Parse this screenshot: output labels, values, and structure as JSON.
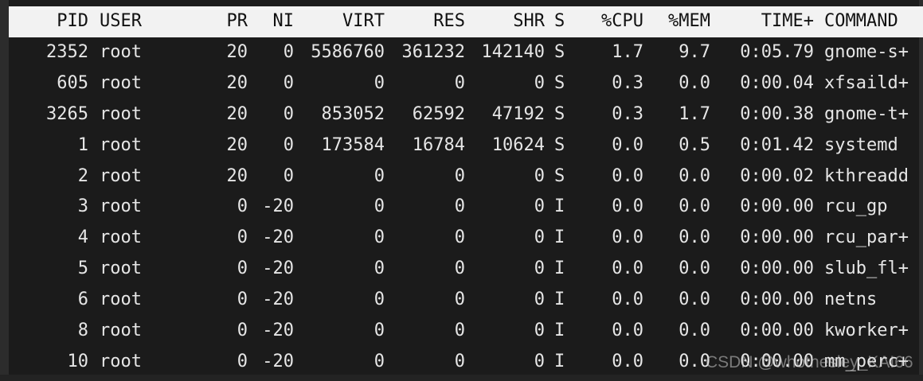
{
  "top": {
    "headers": {
      "pid": "PID",
      "user": "USER",
      "pr": "PR",
      "ni": "NI",
      "virt": "VIRT",
      "res": "RES",
      "shr": "SHR",
      "s": "S",
      "cpu": "%CPU",
      "mem": "%MEM",
      "time": "TIME+",
      "command": "COMMAND"
    },
    "rows": [
      {
        "pid": "2352",
        "user": "root",
        "pr": "20",
        "ni": "0",
        "virt": "5586760",
        "res": "361232",
        "shr": "142140",
        "s": "S",
        "cpu": "1.7",
        "mem": "9.7",
        "time": "0:05.79",
        "command": "gnome-s+"
      },
      {
        "pid": "605",
        "user": "root",
        "pr": "20",
        "ni": "0",
        "virt": "0",
        "res": "0",
        "shr": "0",
        "s": "S",
        "cpu": "0.3",
        "mem": "0.0",
        "time": "0:00.04",
        "command": "xfsaild+"
      },
      {
        "pid": "3265",
        "user": "root",
        "pr": "20",
        "ni": "0",
        "virt": "853052",
        "res": "62592",
        "shr": "47192",
        "s": "S",
        "cpu": "0.3",
        "mem": "1.7",
        "time": "0:00.38",
        "command": "gnome-t+"
      },
      {
        "pid": "1",
        "user": "root",
        "pr": "20",
        "ni": "0",
        "virt": "173584",
        "res": "16784",
        "shr": "10624",
        "s": "S",
        "cpu": "0.0",
        "mem": "0.5",
        "time": "0:01.42",
        "command": "systemd"
      },
      {
        "pid": "2",
        "user": "root",
        "pr": "20",
        "ni": "0",
        "virt": "0",
        "res": "0",
        "shr": "0",
        "s": "S",
        "cpu": "0.0",
        "mem": "0.0",
        "time": "0:00.02",
        "command": "kthreadd"
      },
      {
        "pid": "3",
        "user": "root",
        "pr": "0",
        "ni": "-20",
        "virt": "0",
        "res": "0",
        "shr": "0",
        "s": "I",
        "cpu": "0.0",
        "mem": "0.0",
        "time": "0:00.00",
        "command": "rcu_gp"
      },
      {
        "pid": "4",
        "user": "root",
        "pr": "0",
        "ni": "-20",
        "virt": "0",
        "res": "0",
        "shr": "0",
        "s": "I",
        "cpu": "0.0",
        "mem": "0.0",
        "time": "0:00.00",
        "command": "rcu_par+"
      },
      {
        "pid": "5",
        "user": "root",
        "pr": "0",
        "ni": "-20",
        "virt": "0",
        "res": "0",
        "shr": "0",
        "s": "I",
        "cpu": "0.0",
        "mem": "0.0",
        "time": "0:00.00",
        "command": "slub_fl+"
      },
      {
        "pid": "6",
        "user": "root",
        "pr": "0",
        "ni": "-20",
        "virt": "0",
        "res": "0",
        "shr": "0",
        "s": "I",
        "cpu": "0.0",
        "mem": "0.0",
        "time": "0:00.00",
        "command": "netns"
      },
      {
        "pid": "8",
        "user": "root",
        "pr": "0",
        "ni": "-20",
        "virt": "0",
        "res": "0",
        "shr": "0",
        "s": "I",
        "cpu": "0.0",
        "mem": "0.0",
        "time": "0:00.00",
        "command": "kworker+"
      },
      {
        "pid": "10",
        "user": "root",
        "pr": "0",
        "ni": "-20",
        "virt": "0",
        "res": "0",
        "shr": "0",
        "s": "I",
        "cpu": "0.0",
        "mem": "0.0",
        "time": "0:00.00",
        "command": "mm_perc+"
      }
    ]
  },
  "watermark": "CSDN @whothesley_KAI66",
  "colors": {
    "terminal_bg": "#1b1b1b",
    "header_bg": "#f2f2f2",
    "header_fg": "#111111",
    "text_fg": "#e6e6e6"
  }
}
